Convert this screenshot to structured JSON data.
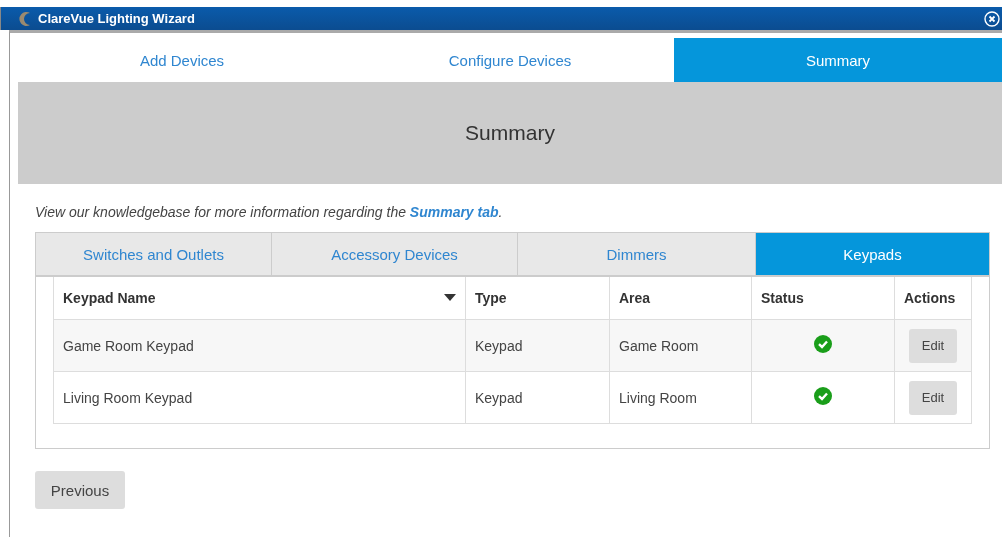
{
  "window": {
    "title": "ClareVue Lighting Wizard"
  },
  "steps": [
    {
      "label": "Add Devices",
      "selected": false
    },
    {
      "label": "Configure Devices",
      "selected": false
    },
    {
      "label": "Summary",
      "selected": true
    }
  ],
  "header": {
    "title": "Summary"
  },
  "info": {
    "text": "View our knowledgebase for more information regarding the ",
    "link": "Summary tab",
    "end": "."
  },
  "tabs": [
    {
      "label": "Switches and Outlets",
      "selected": false
    },
    {
      "label": "Accessory Devices",
      "selected": false
    },
    {
      "label": "Dimmers",
      "selected": false
    },
    {
      "label": "Keypads",
      "selected": true
    }
  ],
  "table": {
    "columns": [
      {
        "label": "Keypad Name",
        "sorted": true
      },
      {
        "label": "Type",
        "sorted": false
      },
      {
        "label": "Area",
        "sorted": false
      },
      {
        "label": "Status",
        "sorted": false
      },
      {
        "label": "Actions",
        "sorted": false
      }
    ],
    "rows": [
      {
        "name": "Game Room Keypad",
        "type": "Keypad",
        "area": "Game Room",
        "complete": true,
        "action": "Edit"
      },
      {
        "name": "Living Room Keypad",
        "type": "Keypad",
        "area": "Living Room",
        "complete": true,
        "action": "Edit"
      }
    ]
  },
  "buttons": [
    {
      "label": "Previous"
    }
  ]
}
